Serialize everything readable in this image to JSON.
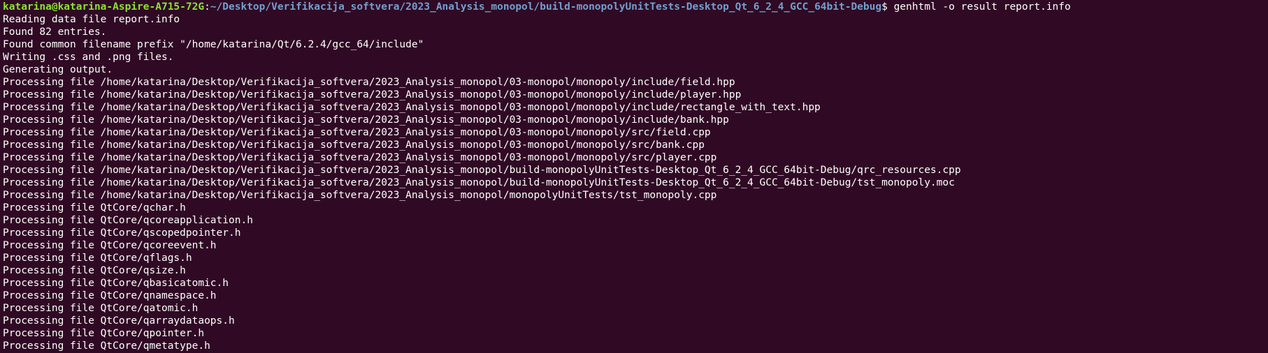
{
  "terminal": {
    "prompt": {
      "user_host": "katarina@katarina-Aspire-A715-72G",
      "colon": ":",
      "path": "~/Desktop/Verifikacija_softvera/2023_Analysis_monopol/build-monopolyUnitTests-Desktop_Qt_6_2_4_GCC_64bit-Debug",
      "dollar": "$ ",
      "command": "genhtml -o result report.info"
    },
    "lines": [
      "Reading data file report.info",
      "Found 82 entries.",
      "Found common filename prefix \"/home/katarina/Qt/6.2.4/gcc_64/include\"",
      "Writing .css and .png files.",
      "Generating output.",
      "Processing file /home/katarina/Desktop/Verifikacija_softvera/2023_Analysis_monopol/03-monopol/monopoly/include/field.hpp",
      "Processing file /home/katarina/Desktop/Verifikacija_softvera/2023_Analysis_monopol/03-monopol/monopoly/include/player.hpp",
      "Processing file /home/katarina/Desktop/Verifikacija_softvera/2023_Analysis_monopol/03-monopol/monopoly/include/rectangle_with_text.hpp",
      "Processing file /home/katarina/Desktop/Verifikacija_softvera/2023_Analysis_monopol/03-monopol/monopoly/include/bank.hpp",
      "Processing file /home/katarina/Desktop/Verifikacija_softvera/2023_Analysis_monopol/03-monopol/monopoly/src/field.cpp",
      "Processing file /home/katarina/Desktop/Verifikacija_softvera/2023_Analysis_monopol/03-monopol/monopoly/src/bank.cpp",
      "Processing file /home/katarina/Desktop/Verifikacija_softvera/2023_Analysis_monopol/03-monopol/monopoly/src/player.cpp",
      "Processing file /home/katarina/Desktop/Verifikacija_softvera/2023_Analysis_monopol/build-monopolyUnitTests-Desktop_Qt_6_2_4_GCC_64bit-Debug/qrc_resources.cpp",
      "Processing file /home/katarina/Desktop/Verifikacija_softvera/2023_Analysis_monopol/build-monopolyUnitTests-Desktop_Qt_6_2_4_GCC_64bit-Debug/tst_monopoly.moc",
      "Processing file /home/katarina/Desktop/Verifikacija_softvera/2023_Analysis_monopol/monopolyUnitTests/tst_monopoly.cpp",
      "Processing file QtCore/qchar.h",
      "Processing file QtCore/qcoreapplication.h",
      "Processing file QtCore/qscopedpointer.h",
      "Processing file QtCore/qcoreevent.h",
      "Processing file QtCore/qflags.h",
      "Processing file QtCore/qsize.h",
      "Processing file QtCore/qbasicatomic.h",
      "Processing file QtCore/qnamespace.h",
      "Processing file QtCore/qatomic.h",
      "Processing file QtCore/qarraydataops.h",
      "Processing file QtCore/qpointer.h",
      "Processing file QtCore/qmetatype.h"
    ]
  }
}
